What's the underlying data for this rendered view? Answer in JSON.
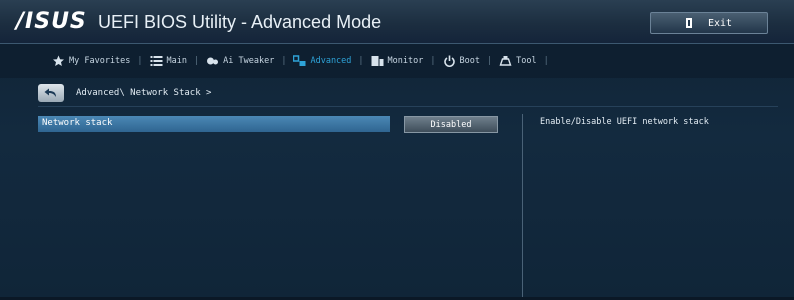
{
  "header": {
    "logo": "/ISUS",
    "title": "UEFI BIOS Utility - Advanced Mode",
    "exit_label": "Exit",
    "exit_icon": "door-exit-icon"
  },
  "tabs": [
    {
      "label": "My Favorites",
      "icon": "star-icon",
      "active": false
    },
    {
      "label": "Main",
      "icon": "list-icon",
      "active": false
    },
    {
      "label": "Ai Tweaker",
      "icon": "tweaker-icon",
      "active": false
    },
    {
      "label": "Advanced",
      "icon": "advanced-icon",
      "active": true
    },
    {
      "label": "Monitor",
      "icon": "monitor-icon",
      "active": false
    },
    {
      "label": "Boot",
      "icon": "power-icon",
      "active": false
    },
    {
      "label": "Tool",
      "icon": "tool-icon",
      "active": false
    }
  ],
  "breadcrumb": {
    "path": "Advanced\\ Network Stack >",
    "back_icon": "back-arrow-icon"
  },
  "settings": [
    {
      "label": "Network stack",
      "value": "Disabled"
    }
  ],
  "help": {
    "text": "Enable/Disable UEFI network stack"
  },
  "colors": {
    "accent": "#2ea3d8",
    "selected_row": "#3f79a6",
    "background": "#13293d"
  }
}
